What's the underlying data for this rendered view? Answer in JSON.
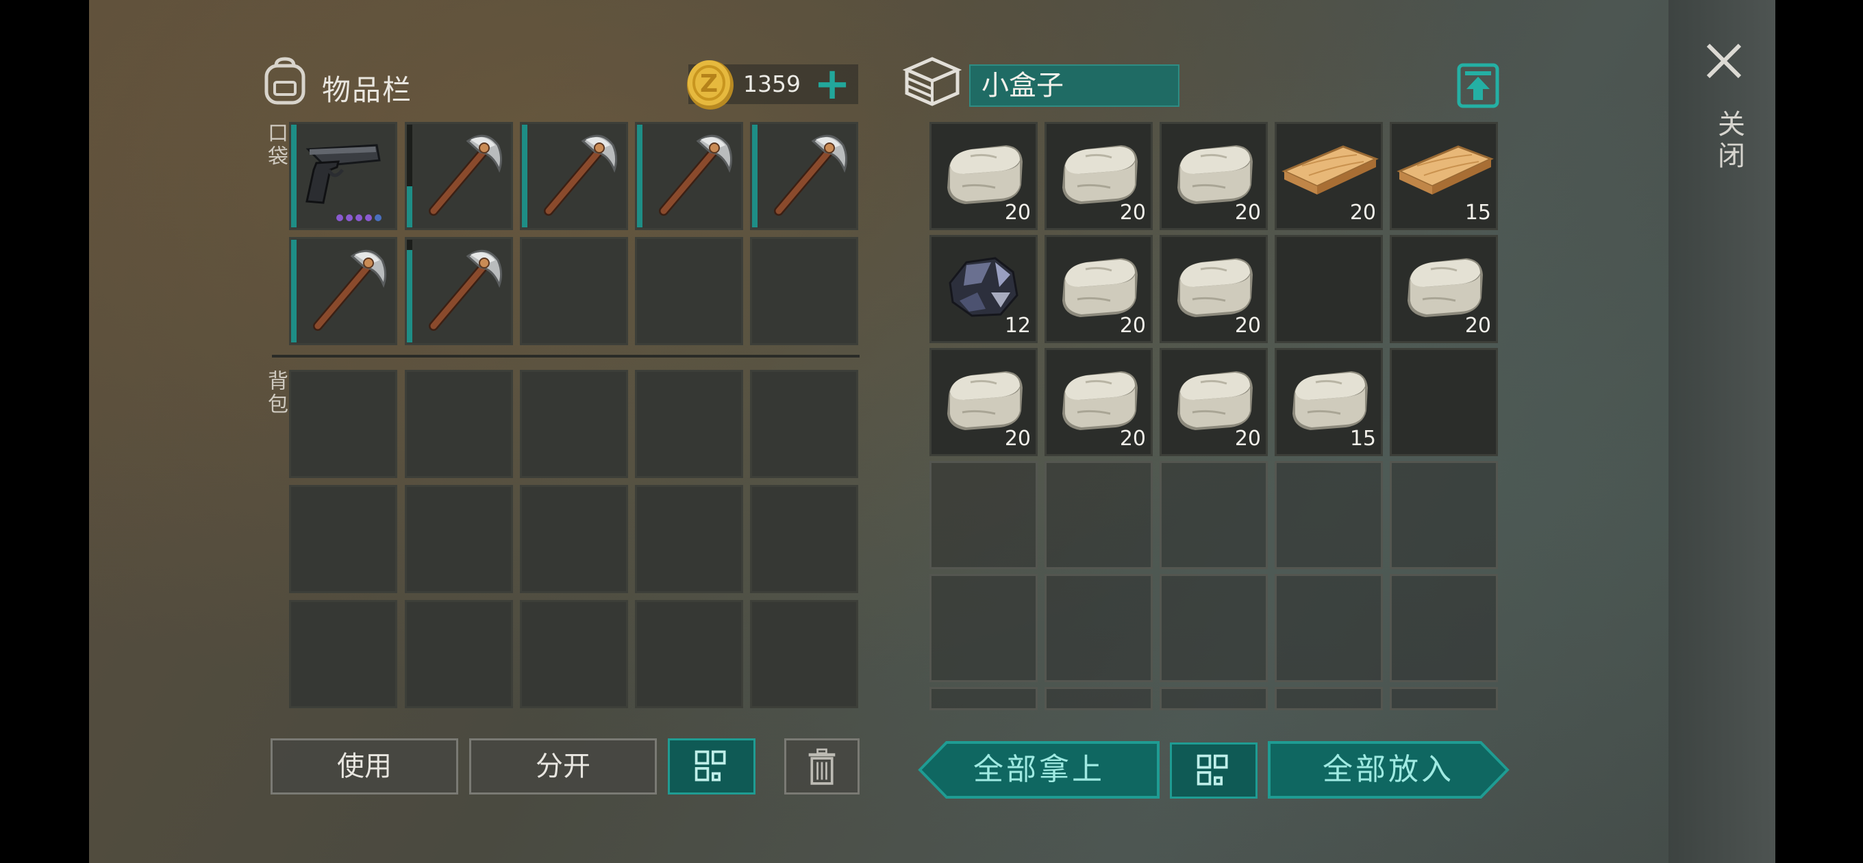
{
  "inventory": {
    "title": "物品栏",
    "coins": "1359",
    "plus": "+",
    "pocket_label": "口袋",
    "backpack_label": "背包"
  },
  "pocket_slots": [
    {
      "item": "pistol-icon",
      "bar": 1.0
    },
    {
      "item": "pickaxe-icon",
      "bar": 0.4
    },
    {
      "item": "pickaxe-icon",
      "bar": 1.0
    },
    {
      "item": "pickaxe-icon",
      "bar": 1.0
    },
    {
      "item": "pickaxe-icon",
      "bar": 1.0
    },
    {
      "item": "pickaxe-icon",
      "bar": 1.0
    },
    {
      "item": "pickaxe-icon",
      "bar": 0.9
    },
    {
      "item": null
    },
    {
      "item": null
    },
    {
      "item": null
    }
  ],
  "storage": {
    "name": "小盒子",
    "slots": [
      {
        "item": "stone-icon",
        "count": "20"
      },
      {
        "item": "stone-icon",
        "count": "20"
      },
      {
        "item": "stone-icon",
        "count": "20"
      },
      {
        "item": "plank-icon",
        "count": "20"
      },
      {
        "item": "plank-icon",
        "count": "15"
      },
      {
        "item": "iron-ore-icon",
        "count": "12"
      },
      {
        "item": "stone-icon",
        "count": "20"
      },
      {
        "item": "stone-icon",
        "count": "20"
      },
      {
        "item": null,
        "count": ""
      },
      {
        "item": "stone-icon",
        "count": "20"
      },
      {
        "item": "stone-icon",
        "count": "20"
      },
      {
        "item": "stone-icon",
        "count": "20"
      },
      {
        "item": "stone-icon",
        "count": "20"
      },
      {
        "item": "stone-icon",
        "count": "15"
      },
      {
        "item": null,
        "count": ""
      }
    ]
  },
  "buttons": {
    "use": "使用",
    "split": "分开",
    "take_all": "全部拿上",
    "put_all": "全部放入",
    "close": "关闭"
  },
  "colors": {
    "accent": "#1f9c93",
    "accent_dark": "#0f5a55",
    "coin": "#e2b23a"
  }
}
